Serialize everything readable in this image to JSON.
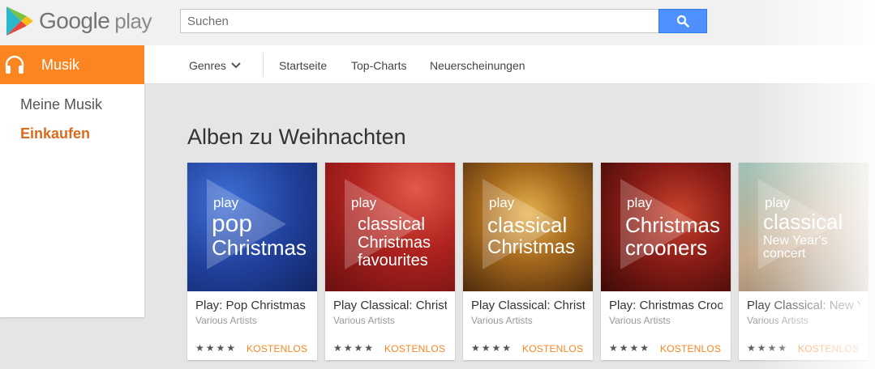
{
  "header": {
    "logo_word": "Google",
    "logo_play": "play",
    "search": {
      "placeholder": "Suchen",
      "value": ""
    }
  },
  "leftnav": {
    "section_label": "Musik",
    "items": [
      {
        "label": "Meine Musik",
        "active": false
      },
      {
        "label": "Einkaufen",
        "active": true
      }
    ]
  },
  "subnav": {
    "genres_label": "Genres",
    "items": [
      {
        "label": "Startseite"
      },
      {
        "label": "Top-Charts"
      },
      {
        "label": "Neuerscheinungen"
      }
    ]
  },
  "section": {
    "title": "Alben zu Weihnachten"
  },
  "albums": [
    {
      "cover_play": "play",
      "cover_line1": "pop",
      "cover_line2": "Christmas",
      "cover_line3": "",
      "title": "Play: Pop Christmas",
      "artist": "Various Artists",
      "price": "KOSTENLOS",
      "rating": 4
    },
    {
      "cover_play": "play",
      "cover_line1": "classical",
      "cover_line2": "Christmas",
      "cover_line3": "favourites",
      "title": "Play Classical: Christmas Favourites",
      "artist": "Various Artists",
      "price": "KOSTENLOS",
      "rating": 4
    },
    {
      "cover_play": "play",
      "cover_line1": "classical",
      "cover_line2": "Christmas",
      "cover_line3": "",
      "title": "Play Classical: Christmas",
      "artist": "Various Artists",
      "price": "KOSTENLOS",
      "rating": 4
    },
    {
      "cover_play": "play",
      "cover_line1": "Christmas",
      "cover_line2": "crooners",
      "cover_line3": "",
      "title": "Play: Christmas Crooners",
      "artist": "Various Artists",
      "price": "KOSTENLOS",
      "rating": 4
    },
    {
      "cover_play": "play",
      "cover_line1": "classical",
      "cover_line2": "New Year's",
      "cover_line3": "concert",
      "title": "Play Classical: New Year's Concert",
      "artist": "Various Artists",
      "price": "KOSTENLOS",
      "rating": 4
    }
  ],
  "colors": {
    "brand_orange": "#fb8521",
    "active_nav": "#dc6a1c",
    "search_button": "#4d90fe"
  },
  "icons": {
    "logo": "google-play-triangle-icon",
    "search": "magnifier-icon",
    "music": "headphones-icon",
    "genres_chevron": "chevron-down-icon"
  }
}
